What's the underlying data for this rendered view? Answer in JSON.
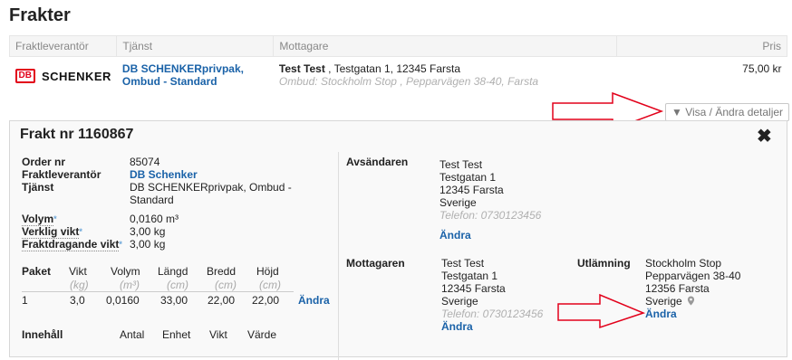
{
  "title": "Frakter",
  "table": {
    "headers": [
      "Fraktleverantör",
      "Tjänst",
      "Mottagare",
      "Pris"
    ],
    "row": {
      "carrier_logo_db": "DB",
      "carrier_logo_name": "SCHENKER",
      "service_line1": "DB SCHENKERprivpak,",
      "service_line2": "Ombud - Standard",
      "recipient_name": "Test Test",
      "recipient_address": " , Testgatan 1, 12345 Farsta",
      "recipient_pickup": "Ombud: Stockholm Stop , Pepparvägen 38-40, Farsta",
      "price": "75,00 kr"
    }
  },
  "details_button": "▼ Visa / Ändra detaljer",
  "panel": {
    "title": "Frakt nr 1160867",
    "close": "✖",
    "order_label": "Order nr",
    "order_value": "85074",
    "carrier_label": "Fraktleverantör",
    "carrier_value": "DB Schenker",
    "service_label": "Tjänst",
    "service_value_1": "DB SCHENKERprivpak, Ombud -",
    "service_value_2": "Standard",
    "volume_label": "Volym",
    "volume_value": "0,0160 m³",
    "weight_label": "Verklig vikt",
    "weight_value": "3,00 kg",
    "charge_label": "Fraktdragande vikt",
    "charge_value": "3,00 kg",
    "star": "*",
    "packages": {
      "headers": [
        "Paket",
        "Vikt",
        "Volym",
        "Längd",
        "Bredd",
        "Höjd"
      ],
      "units": [
        "(kg)",
        "(m³)",
        "(cm)",
        "(cm)",
        "(cm)"
      ],
      "row": [
        "1",
        "3,0",
        "0,0160",
        "33,00",
        "22,00",
        "22,00"
      ],
      "edit": "Ändra"
    },
    "content": {
      "headers": [
        "Innehåll",
        "Antal",
        "Enhet",
        "Vikt",
        "Värde"
      ]
    },
    "sender": {
      "label": "Avsändaren",
      "name": "Test Test",
      "street": "Testgatan 1",
      "city": "12345 Farsta",
      "country": "Sverige",
      "phone": "Telefon: 0730123456",
      "edit": "Ändra"
    },
    "receiver": {
      "label": "Mottagaren",
      "name": "Test Test",
      "street": "Testgatan 1",
      "city": "12345 Farsta",
      "country": "Sverige",
      "phone": "Telefon: 0730123456",
      "edit": "Ändra"
    },
    "delivery": {
      "label": "Utlämning",
      "name": "Stockholm Stop",
      "street": "Pepparvägen 38-40",
      "city": "12356 Farsta",
      "country": "Sverige",
      "edit": "Ändra"
    }
  },
  "colors": {
    "link": "#1a62a8",
    "brand": "#e2001a",
    "annotation": "#e2001a"
  }
}
